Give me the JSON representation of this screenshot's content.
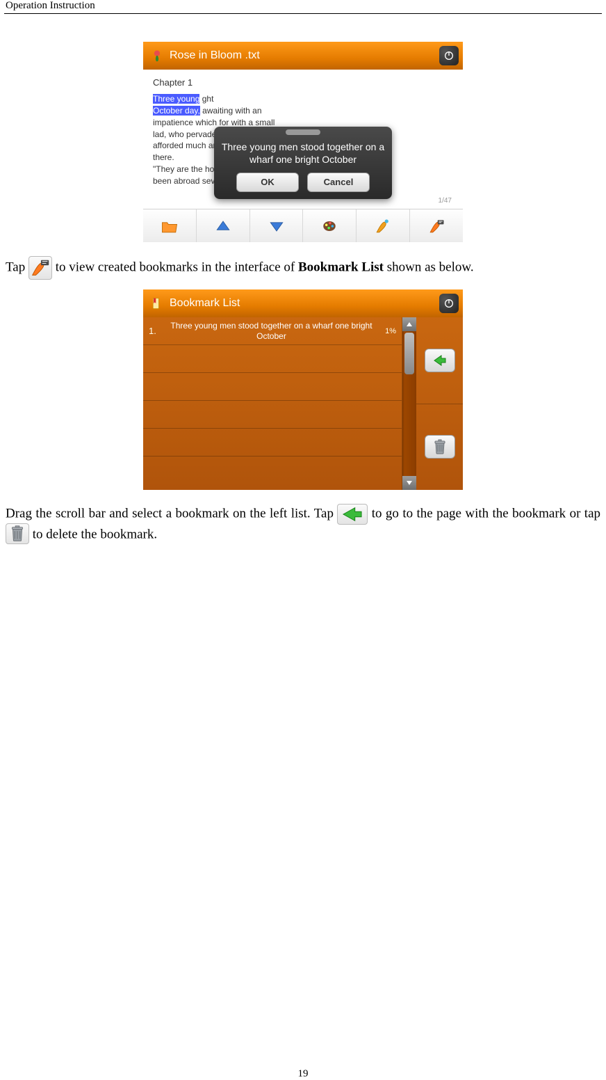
{
  "header": "Operation Instruction",
  "page_number": "19",
  "reader": {
    "title": "Rose in Bloom .txt",
    "chapter": "Chapter 1",
    "hl_line1": "Three young",
    "hl_line1_rest": "                                                                 ght",
    "hl_line2": "October day,",
    "body_l2_rest": " awaiting                                                      with an",
    "body_l3": "impatience which for                                           with a small",
    "body_l4": "lad, who pervaded the pa                                   o'-the-wisp and",
    "body_l5": "afforded much amusement to                                     assembled",
    "body_l6": "there.",
    "body_l7": "   \"They are the                                                       ho has",
    "body_l8": "been abroad several years with her uncle, the doctor,\"",
    "progress": "1/47"
  },
  "dialog": {
    "text": "Three young men stood together on a wharf one bright October",
    "ok": "OK",
    "cancel": "Cancel"
  },
  "para1_a": "Tap ",
  "para1_b": " to view created bookmarks in the interface of ",
  "para1_bold": "Bookmark List",
  "para1_c": " shown as below.",
  "bookmark_list": {
    "title": "Bookmark List",
    "rows": [
      {
        "num": "1.",
        "text": "Three young men stood together on a wharf one bright October",
        "pct": "1%"
      }
    ]
  },
  "para2_a": "Drag the scroll bar and select a bookmark on the left list. Tap ",
  "para2_b": " to go to the page with the bookmark or tap ",
  "para2_c": " to delete the bookmark."
}
